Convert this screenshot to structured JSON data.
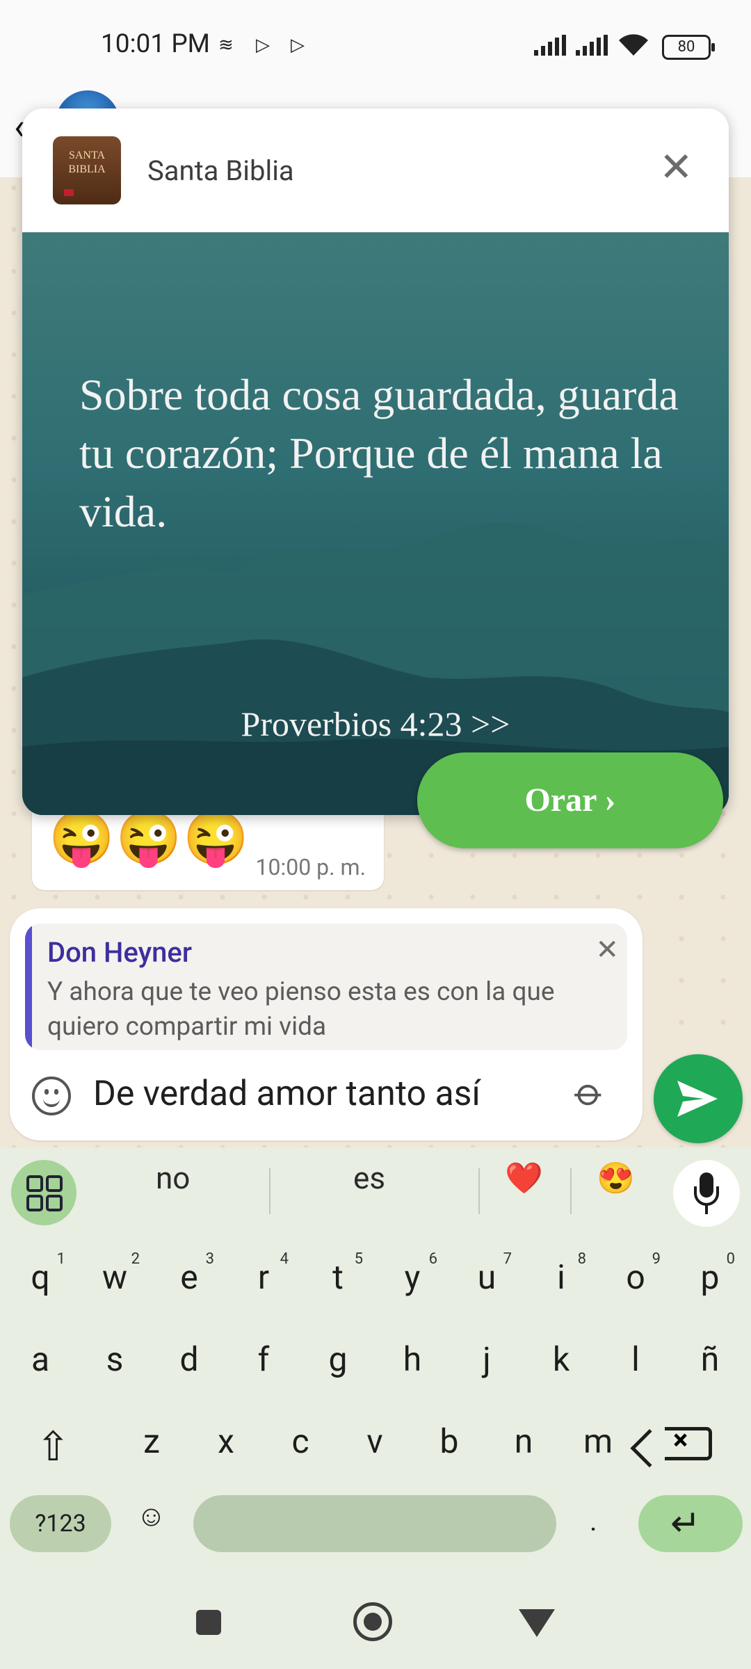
{
  "status_bar": {
    "time": "10:01 PM",
    "battery": "80"
  },
  "popup": {
    "app_icon_text": "SANTA BIBLIA",
    "title": "Santa Biblia",
    "verse": "Sobre toda cosa guardada, guarda tu corazón; Porque de él mana la vida.",
    "reference": "Proverbios 4:23 >>",
    "action_label": "Orar ›"
  },
  "message": {
    "emojis": "😜😜😜",
    "time": "10:00 p. m."
  },
  "reply_preview": {
    "author": "Don Heyner",
    "text": "Y ahora que te veo pienso esta es con la que quiero compartir mi vida"
  },
  "composer": {
    "value": "De verdad amor tanto así"
  },
  "keyboard": {
    "suggestions": [
      "no",
      "es",
      "❤️",
      "😍"
    ],
    "row1": [
      {
        "k": "q",
        "s": "1"
      },
      {
        "k": "w",
        "s": "2"
      },
      {
        "k": "e",
        "s": "3"
      },
      {
        "k": "r",
        "s": "4"
      },
      {
        "k": "t",
        "s": "5"
      },
      {
        "k": "y",
        "s": "6"
      },
      {
        "k": "u",
        "s": "7"
      },
      {
        "k": "i",
        "s": "8"
      },
      {
        "k": "o",
        "s": "9"
      },
      {
        "k": "p",
        "s": "0"
      }
    ],
    "row2": [
      "a",
      "s",
      "d",
      "f",
      "g",
      "h",
      "j",
      "k",
      "l",
      "ñ"
    ],
    "row3": [
      "z",
      "x",
      "c",
      "v",
      "b",
      "n",
      "m"
    ],
    "symbols_label": "?123",
    "period": "."
  },
  "colors": {
    "accent_green": "#1fa855",
    "pray_button": "#5fbe50",
    "reply_bar": "#5a4fcf"
  }
}
